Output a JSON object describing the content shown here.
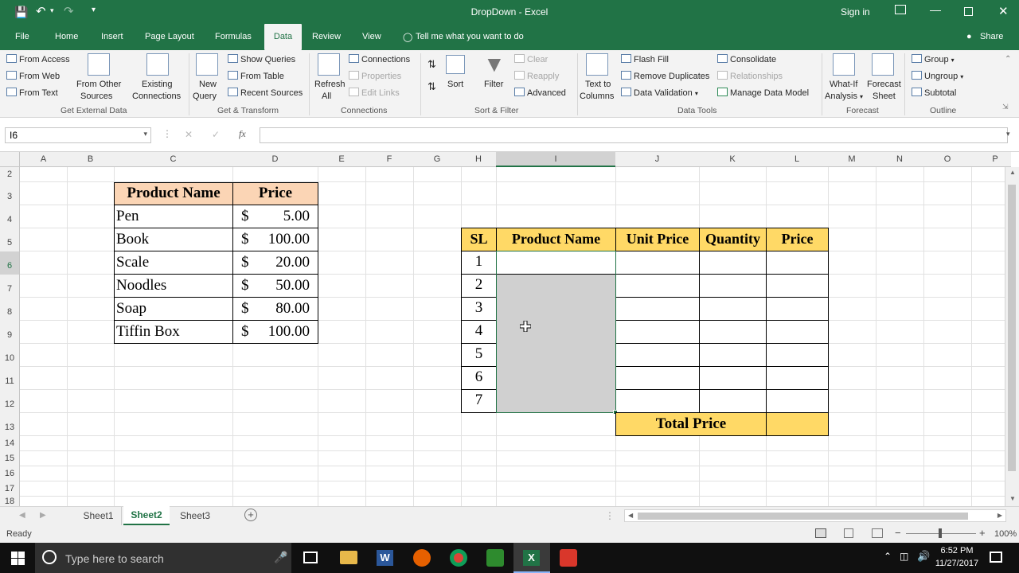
{
  "window": {
    "title": "DropDown  -  Excel",
    "signin": "Sign in",
    "colors": {
      "brand": "#217346",
      "header_fill": "#fbd5b5",
      "yellow_fill": "#ffd966",
      "selected_fill": "#d0d0d0"
    }
  },
  "tabs": [
    "File",
    "Home",
    "Insert",
    "Page Layout",
    "Formulas",
    "Data",
    "Review",
    "View"
  ],
  "active_tab": "Data",
  "tell_me": "Tell me what you want to do",
  "share": "Share",
  "ribbon": {
    "get_external": {
      "from_access": "From Access",
      "from_web": "From Web",
      "from_text": "From Text",
      "from_other_1": "From Other",
      "from_other_2": "Sources",
      "existing_1": "Existing",
      "existing_2": "Connections",
      "label": "Get External Data"
    },
    "get_transform": {
      "new_query_1": "New",
      "new_query_2": "Query",
      "show_queries": "Show Queries",
      "from_table": "From Table",
      "recent_sources": "Recent Sources",
      "label": "Get & Transform"
    },
    "connections": {
      "refresh_1": "Refresh",
      "refresh_2": "All",
      "connections": "Connections",
      "properties": "Properties",
      "edit_links": "Edit Links",
      "label": "Connections"
    },
    "sort_filter": {
      "sort": "Sort",
      "filter": "Filter",
      "clear": "Clear",
      "reapply": "Reapply",
      "advanced": "Advanced",
      "label": "Sort & Filter"
    },
    "data_tools": {
      "text_to_1": "Text to",
      "text_to_2": "Columns",
      "flash_fill": "Flash Fill",
      "remove_dup": "Remove Duplicates",
      "data_validation": "Data Validation",
      "consolidate": "Consolidate",
      "relationships": "Relationships",
      "manage_model": "Manage Data Model",
      "label": "Data Tools"
    },
    "forecast": {
      "whatif_1": "What-If",
      "whatif_2": "Analysis",
      "forecast_1": "Forecast",
      "forecast_2": "Sheet",
      "label": "Forecast"
    },
    "outline": {
      "group": "Group",
      "ungroup": "Ungroup",
      "subtotal": "Subtotal",
      "label": "Outline"
    }
  },
  "name_box": "I6",
  "formula_buttons": [
    "✕",
    "✓",
    "fx"
  ],
  "columns": [
    "A",
    "B",
    "C",
    "D",
    "E",
    "F",
    "G",
    "H",
    "I",
    "J",
    "K",
    "L",
    "M",
    "N",
    "O",
    "P"
  ],
  "rows": [
    "2",
    "3",
    "4",
    "5",
    "6",
    "7",
    "8",
    "9",
    "10",
    "11",
    "12",
    "13",
    "14",
    "15",
    "16",
    "17",
    "18"
  ],
  "product_table": {
    "headers": [
      "Product Name",
      "Price"
    ],
    "rows": [
      {
        "name": "Pen",
        "currency": "$",
        "price": "5.00"
      },
      {
        "name": "Book",
        "currency": "$",
        "price": "100.00"
      },
      {
        "name": "Scale",
        "currency": "$",
        "price": "20.00"
      },
      {
        "name": "Noodles",
        "currency": "$",
        "price": "50.00"
      },
      {
        "name": "Soap",
        "currency": "$",
        "price": "80.00"
      },
      {
        "name": "Tiffin Box",
        "currency": "$",
        "price": "100.00"
      }
    ]
  },
  "order_table": {
    "headers": [
      "SL",
      "Product Name",
      "Unit Price",
      "Quantity",
      "Price"
    ],
    "sl": [
      "1",
      "2",
      "3",
      "4",
      "5",
      "6",
      "7"
    ],
    "total_label": "Total Price"
  },
  "sheets": [
    "Sheet1",
    "Sheet2",
    "Sheet3"
  ],
  "active_sheet": "Sheet2",
  "status": {
    "ready": "Ready",
    "zoom": "100%"
  },
  "taskbar": {
    "search_placeholder": "Type here to search",
    "time": "6:52 PM",
    "date": "11/27/2017"
  }
}
